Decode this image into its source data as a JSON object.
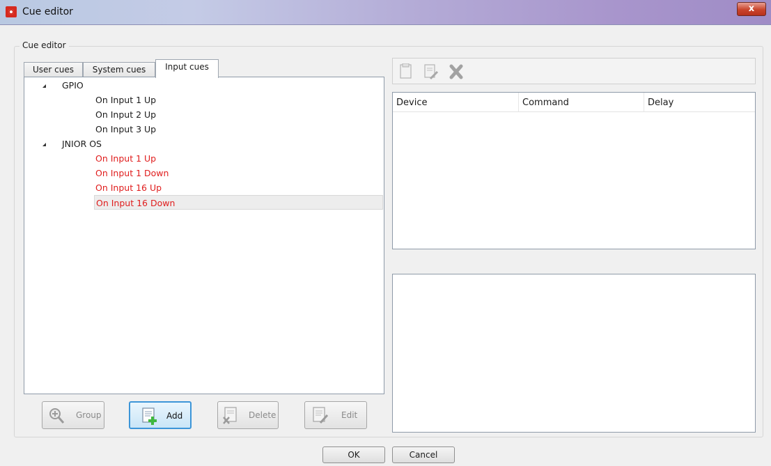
{
  "window": {
    "title": "Cue editor",
    "close_glyph": "x"
  },
  "group": {
    "label": "Cue editor"
  },
  "tabs": [
    {
      "label": "User cues",
      "active": false
    },
    {
      "label": "System cues",
      "active": false
    },
    {
      "label": "Input cues",
      "active": true
    }
  ],
  "tree": {
    "groups": [
      {
        "label": "GPIO",
        "items": [
          "On Input 1 Up",
          "On Input 2 Up",
          "On Input 3 Up"
        ]
      },
      {
        "label": "JNIOR OS",
        "items": [
          "On Input 1 Up",
          "On Input 1 Down",
          "On Input 16 Up",
          "On Input 16 Down"
        ]
      }
    ],
    "selected": "On Input 16 Down",
    "red_color": "#e01d1d"
  },
  "buttons": {
    "group": "Group",
    "add": "Add",
    "delete": "Delete",
    "edit": "Edit"
  },
  "toolbar_icons": [
    "new-document-icon",
    "edit-document-icon",
    "delete-x-icon"
  ],
  "grid": {
    "columns": [
      "Device",
      "Command",
      "Delay"
    ]
  },
  "dialog": {
    "ok": "OK",
    "cancel": "Cancel"
  }
}
